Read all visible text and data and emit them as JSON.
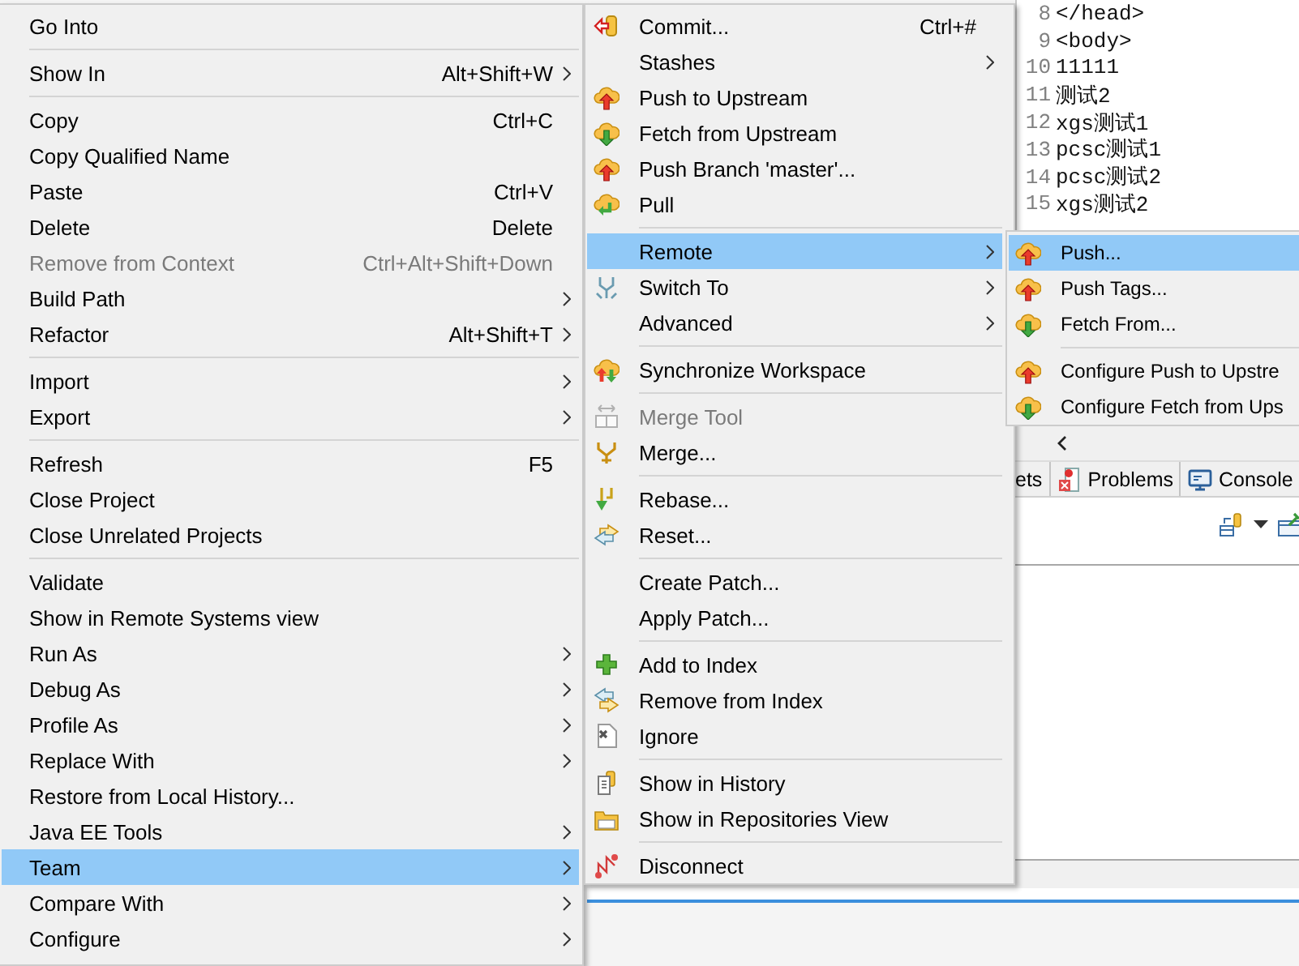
{
  "editor": {
    "lines": [
      {
        "number": "8",
        "text": "</head>"
      },
      {
        "number": "9",
        "text": "<body>"
      },
      {
        "number": "10",
        "text": "11111"
      },
      {
        "number": "11",
        "text": "测试2"
      },
      {
        "number": "12",
        "text": "xgs测试1"
      },
      {
        "number": "13",
        "text": "pcsc测试1"
      },
      {
        "number": "14",
        "text": "pcsc测试2"
      },
      {
        "number": "15",
        "text": "xgs测试2"
      }
    ]
  },
  "bottom_panel": {
    "tabs": [
      {
        "label": "ets"
      },
      {
        "label": "Problems"
      },
      {
        "label": "Console"
      }
    ]
  },
  "explorer_menu": {
    "items": [
      {
        "kind": "item",
        "label": "Go Into",
        "submenu": false,
        "disabled": false,
        "selected": false
      },
      {
        "kind": "separator"
      },
      {
        "kind": "item",
        "label": "Show In",
        "shortcut": "Alt+Shift+W",
        "submenu": true,
        "disabled": false,
        "selected": false
      },
      {
        "kind": "separator"
      },
      {
        "kind": "item",
        "label": "Copy",
        "shortcut": "Ctrl+C",
        "submenu": false,
        "disabled": false,
        "selected": false
      },
      {
        "kind": "item",
        "label": "Copy Qualified Name",
        "submenu": false,
        "disabled": false,
        "selected": false
      },
      {
        "kind": "item",
        "label": "Paste",
        "shortcut": "Ctrl+V",
        "submenu": false,
        "disabled": false,
        "selected": false
      },
      {
        "kind": "item",
        "label": "Delete",
        "shortcut": "Delete",
        "submenu": false,
        "disabled": false,
        "selected": false
      },
      {
        "kind": "item",
        "label": "Remove from Context",
        "shortcut": "Ctrl+Alt+Shift+Down",
        "submenu": false,
        "disabled": true,
        "selected": false
      },
      {
        "kind": "item",
        "label": "Build Path",
        "submenu": true,
        "disabled": false,
        "selected": false
      },
      {
        "kind": "item",
        "label": "Refactor",
        "shortcut": "Alt+Shift+T",
        "submenu": true,
        "disabled": false,
        "selected": false
      },
      {
        "kind": "separator"
      },
      {
        "kind": "item",
        "label": "Import",
        "submenu": true,
        "disabled": false,
        "selected": false
      },
      {
        "kind": "item",
        "label": "Export",
        "submenu": true,
        "disabled": false,
        "selected": false
      },
      {
        "kind": "separator"
      },
      {
        "kind": "item",
        "label": "Refresh",
        "shortcut": "F5",
        "submenu": false,
        "disabled": false,
        "selected": false
      },
      {
        "kind": "item",
        "label": "Close Project",
        "submenu": false,
        "disabled": false,
        "selected": false
      },
      {
        "kind": "item",
        "label": "Close Unrelated Projects",
        "submenu": false,
        "disabled": false,
        "selected": false
      },
      {
        "kind": "separator"
      },
      {
        "kind": "item",
        "label": "Validate",
        "submenu": false,
        "disabled": false,
        "selected": false
      },
      {
        "kind": "item",
        "label": "Show in Remote Systems view",
        "submenu": false,
        "disabled": false,
        "selected": false
      },
      {
        "kind": "item",
        "label": "Run As",
        "submenu": true,
        "disabled": false,
        "selected": false
      },
      {
        "kind": "item",
        "label": "Debug As",
        "submenu": true,
        "disabled": false,
        "selected": false
      },
      {
        "kind": "item",
        "label": "Profile As",
        "submenu": true,
        "disabled": false,
        "selected": false
      },
      {
        "kind": "item",
        "label": "Replace With",
        "submenu": true,
        "disabled": false,
        "selected": false
      },
      {
        "kind": "item",
        "label": "Restore from Local History...",
        "submenu": false,
        "disabled": false,
        "selected": false
      },
      {
        "kind": "item",
        "label": "Java EE Tools",
        "submenu": true,
        "disabled": false,
        "selected": false
      },
      {
        "kind": "item",
        "label": "Team",
        "submenu": true,
        "disabled": false,
        "selected": true
      },
      {
        "kind": "item",
        "label": "Compare With",
        "submenu": true,
        "disabled": false,
        "selected": false
      },
      {
        "kind": "item",
        "label": "Configure",
        "submenu": true,
        "disabled": false,
        "selected": false
      }
    ]
  },
  "team_menu": {
    "items": [
      {
        "kind": "item",
        "label": "Commit...",
        "shortcut": "Ctrl+#",
        "submenu": false,
        "disabled": false,
        "selected": false
      },
      {
        "kind": "item",
        "label": "Stashes",
        "submenu": true,
        "disabled": false,
        "selected": false
      },
      {
        "kind": "item",
        "label": "Push to Upstream",
        "submenu": false,
        "disabled": false,
        "selected": false
      },
      {
        "kind": "item",
        "label": "Fetch from Upstream",
        "submenu": false,
        "disabled": false,
        "selected": false
      },
      {
        "kind": "item",
        "label": "Push Branch 'master'...",
        "submenu": false,
        "disabled": false,
        "selected": false
      },
      {
        "kind": "item",
        "label": "Pull",
        "submenu": false,
        "disabled": false,
        "selected": false
      },
      {
        "kind": "separator"
      },
      {
        "kind": "item",
        "label": "Remote",
        "submenu": true,
        "disabled": false,
        "selected": true
      },
      {
        "kind": "item",
        "label": "Switch To",
        "submenu": true,
        "disabled": false,
        "selected": false
      },
      {
        "kind": "item",
        "label": "Advanced",
        "submenu": true,
        "disabled": false,
        "selected": false
      },
      {
        "kind": "separator"
      },
      {
        "kind": "item",
        "label": "Synchronize Workspace",
        "submenu": false,
        "disabled": false,
        "selected": false
      },
      {
        "kind": "separator"
      },
      {
        "kind": "item",
        "label": "Merge Tool",
        "submenu": false,
        "disabled": true,
        "selected": false
      },
      {
        "kind": "item",
        "label": "Merge...",
        "submenu": false,
        "disabled": false,
        "selected": false
      },
      {
        "kind": "separator"
      },
      {
        "kind": "item",
        "label": "Rebase...",
        "submenu": false,
        "disabled": false,
        "selected": false
      },
      {
        "kind": "item",
        "label": "Reset...",
        "submenu": false,
        "disabled": false,
        "selected": false
      },
      {
        "kind": "separator"
      },
      {
        "kind": "item",
        "label": "Create Patch...",
        "submenu": false,
        "disabled": false,
        "selected": false
      },
      {
        "kind": "item",
        "label": "Apply Patch...",
        "submenu": false,
        "disabled": false,
        "selected": false
      },
      {
        "kind": "separator"
      },
      {
        "kind": "item",
        "label": "Add to Index",
        "submenu": false,
        "disabled": false,
        "selected": false
      },
      {
        "kind": "item",
        "label": "Remove from Index",
        "submenu": false,
        "disabled": false,
        "selected": false
      },
      {
        "kind": "item",
        "label": "Ignore",
        "submenu": false,
        "disabled": false,
        "selected": false
      },
      {
        "kind": "separator"
      },
      {
        "kind": "item",
        "label": "Show in History",
        "submenu": false,
        "disabled": false,
        "selected": false
      },
      {
        "kind": "item",
        "label": "Show in Repositories View",
        "submenu": false,
        "disabled": false,
        "selected": false
      },
      {
        "kind": "separator"
      },
      {
        "kind": "item",
        "label": "Disconnect",
        "submenu": false,
        "disabled": false,
        "selected": false
      }
    ]
  },
  "remote_menu": {
    "items": [
      {
        "kind": "item",
        "label": "Push...",
        "submenu": false,
        "disabled": false,
        "selected": true
      },
      {
        "kind": "item",
        "label": "Push Tags...",
        "submenu": false,
        "disabled": false,
        "selected": false
      },
      {
        "kind": "item",
        "label": "Fetch From...",
        "submenu": false,
        "disabled": false,
        "selected": false
      },
      {
        "kind": "separator"
      },
      {
        "kind": "item",
        "label": "Configure Push to Upstre",
        "submenu": false,
        "disabled": false,
        "selected": false
      },
      {
        "kind": "item",
        "label": "Configure Fetch from Ups",
        "submenu": false,
        "disabled": false,
        "selected": false
      }
    ]
  }
}
